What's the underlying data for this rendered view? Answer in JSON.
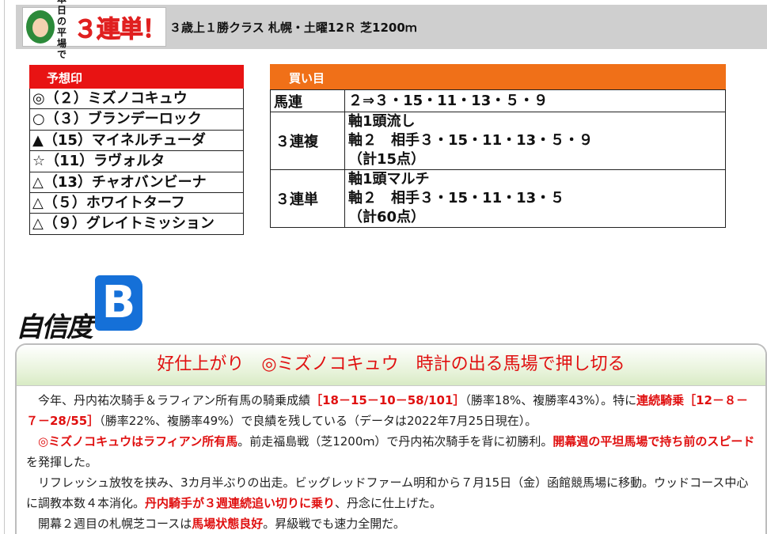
{
  "header": {
    "logo": {
      "small": "本日の平場で",
      "big": "３連単！"
    },
    "race_title": "３歳上１勝クラス 札幌・土曜12Ｒ 芝1200ｍ"
  },
  "prediction": {
    "heading": "予想印",
    "rows": [
      "◎（２）ミズノコキュウ",
      "○（３）ブランデーロック",
      "▲（15）マイネルチューダ",
      "☆（11）ラヴォルタ",
      "△（13）チャオバンビーナ",
      "△（５）ホワイトターフ",
      "△（９）グレイトミッション"
    ]
  },
  "bets": {
    "heading": "買い目",
    "rows": [
      {
        "kind": "馬連",
        "lines": [
          "２⇒３・15・11・13・５・９"
        ]
      },
      {
        "kind": "３連複",
        "lines": [
          "軸1頭流し",
          "軸２　相手３・15・11・13・５・９",
          "（計15点）"
        ]
      },
      {
        "kind": "３連単",
        "lines": [
          "軸1頭マルチ",
          "軸２　相手３・15・11・13・５",
          "（計60点）"
        ]
      }
    ]
  },
  "confidence": {
    "label": "自信度",
    "grade": "B"
  },
  "comment": {
    "headline": "好仕上がり　◎ミズノコキュウ　時計の出る馬場で押し切る",
    "p1": {
      "a": "今年、丹内祐次騎手＆ラフィアン所有馬の騎乗成績",
      "b": "［18－15－10－58/101］",
      "c": "（勝率18%、複勝率43%）。特に",
      "d": "連続騎乗［12－８－７－28/55］",
      "e": "（勝率22%、複勝率49%）で良績を残している（データは2022年7月25日現在）。"
    },
    "p2": {
      "a": "◎ミズノコキュウはラフィアン所有馬",
      "b": "。前走福島戦（芝1200ｍ）で丹内祐次騎手を背に初勝利。",
      "c": "開幕週の平坦馬場で持ち前のスピード",
      "d": "を発揮した。"
    },
    "p3": {
      "a": "リフレッシュ放牧を挟み、3カ月半ぶりの出走。ビッグレッドファーム明和から７月15日（金）函館競馬場に移動。ウッドコース中心に調教本数４本消化。",
      "b": "丹内騎手が３週連続追い切りに乗り",
      "c": "、丹念に仕上げた。"
    },
    "p4": {
      "a": "開幕２週目の札幌芝コースは",
      "b": "馬場状態良好",
      "c": "。昇級戦でも速力全開だ。"
    }
  }
}
